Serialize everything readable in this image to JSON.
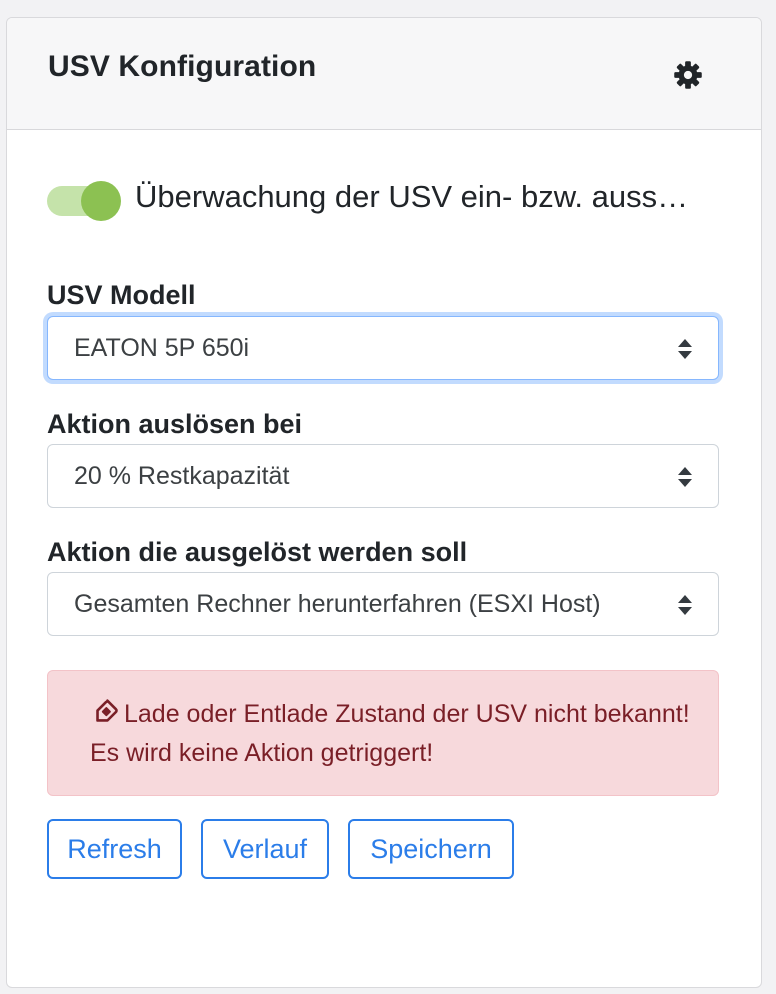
{
  "card": {
    "title": "USV Konfiguration",
    "settings_icon": "gear-icon"
  },
  "monitoring": {
    "enabled": true,
    "label": "Überwachung der USV ein- bzw. auss…",
    "toggle_color": "#8cc152"
  },
  "model": {
    "label": "USV Modell",
    "value": "EATON 5P 650i"
  },
  "trigger": {
    "label": "Aktion auslösen bei",
    "value": "20 % Restkapazität"
  },
  "action": {
    "label": "Aktion die ausgelöst werden soll",
    "value": "Gesamten Rechner herunterfahren (ESXI Host)"
  },
  "alert": {
    "icon": "tag-icon",
    "text": "Lade oder Entlade Zustand der USV nicht bekannt! Es wird keine Aktion getriggert!",
    "background": "#f7d9dc",
    "text_color": "#7a1f27"
  },
  "buttons": {
    "refresh": "Refresh",
    "history": "Verlauf",
    "save": "Speichern",
    "color": "#2b7de9"
  }
}
